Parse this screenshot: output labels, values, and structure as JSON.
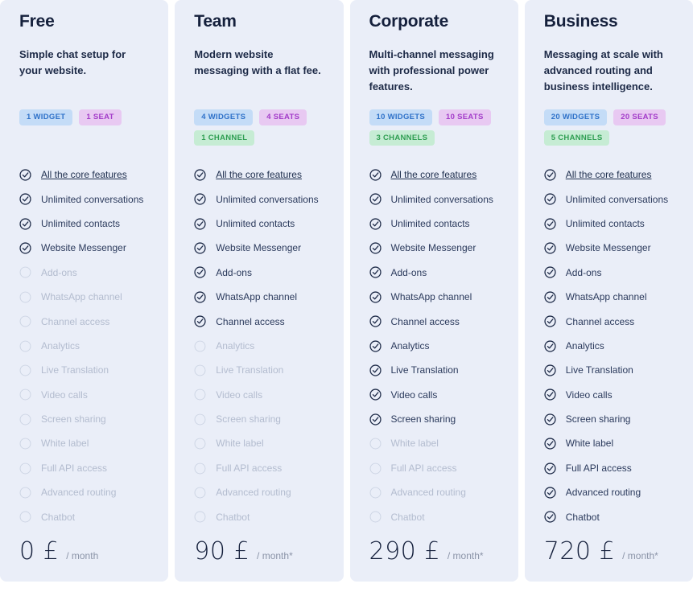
{
  "colors": {
    "page_background": "#ffffff",
    "card_background": "#eaeef8",
    "heading": "#15203c",
    "feature_on": "#2b3a5c",
    "feature_off": "#b3bccf",
    "badge_widgets_bg": "#c4dcf7",
    "badge_widgets_text": "#2f72c9",
    "badge_seats_bg": "#e8c9f2",
    "badge_seats_text": "#a33cc9",
    "badge_channels_bg": "#c6ecd4",
    "badge_channels_text": "#2f9e52"
  },
  "plans": [
    {
      "name": "Free",
      "description": "Simple chat setup for your website.",
      "badges": [
        {
          "label": "1 WIDGET",
          "type": "widgets"
        },
        {
          "label": "1 SEAT",
          "type": "seats"
        }
      ],
      "features": [
        {
          "label": "All the core features",
          "enabled": true,
          "link": true
        },
        {
          "label": "Unlimited conversations",
          "enabled": true,
          "link": false
        },
        {
          "label": "Unlimited contacts",
          "enabled": true,
          "link": false
        },
        {
          "label": "Website Messenger",
          "enabled": true,
          "link": false
        },
        {
          "label": "Add-ons",
          "enabled": false,
          "link": false
        },
        {
          "label": "WhatsApp channel",
          "enabled": false,
          "link": false
        },
        {
          "label": "Channel access",
          "enabled": false,
          "link": false
        },
        {
          "label": "Analytics",
          "enabled": false,
          "link": false
        },
        {
          "label": "Live Translation",
          "enabled": false,
          "link": false
        },
        {
          "label": "Video calls",
          "enabled": false,
          "link": false
        },
        {
          "label": "Screen sharing",
          "enabled": false,
          "link": false
        },
        {
          "label": "White label",
          "enabled": false,
          "link": false
        },
        {
          "label": "Full API access",
          "enabled": false,
          "link": false
        },
        {
          "label": "Advanced routing",
          "enabled": false,
          "link": false
        },
        {
          "label": "Chatbot",
          "enabled": false,
          "link": false
        }
      ],
      "price_amount": "0 £",
      "price_period": "/ month"
    },
    {
      "name": "Team",
      "description": "Modern website messaging with a flat fee.",
      "badges": [
        {
          "label": "4 WIDGETS",
          "type": "widgets"
        },
        {
          "label": "4 SEATS",
          "type": "seats"
        },
        {
          "label": "1 CHANNEL",
          "type": "channels"
        }
      ],
      "features": [
        {
          "label": "All the core features",
          "enabled": true,
          "link": true
        },
        {
          "label": "Unlimited conversations",
          "enabled": true,
          "link": false
        },
        {
          "label": "Unlimited contacts",
          "enabled": true,
          "link": false
        },
        {
          "label": "Website Messenger",
          "enabled": true,
          "link": false
        },
        {
          "label": "Add-ons",
          "enabled": true,
          "link": false
        },
        {
          "label": "WhatsApp channel",
          "enabled": true,
          "link": false
        },
        {
          "label": "Channel access",
          "enabled": true,
          "link": false
        },
        {
          "label": "Analytics",
          "enabled": false,
          "link": false
        },
        {
          "label": "Live Translation",
          "enabled": false,
          "link": false
        },
        {
          "label": "Video calls",
          "enabled": false,
          "link": false
        },
        {
          "label": "Screen sharing",
          "enabled": false,
          "link": false
        },
        {
          "label": "White label",
          "enabled": false,
          "link": false
        },
        {
          "label": "Full API access",
          "enabled": false,
          "link": false
        },
        {
          "label": "Advanced routing",
          "enabled": false,
          "link": false
        },
        {
          "label": "Chatbot",
          "enabled": false,
          "link": false
        }
      ],
      "price_amount": "90 £",
      "price_period": "/ month*"
    },
    {
      "name": "Corporate",
      "description": "Multi-channel messaging with professional power features.",
      "badges": [
        {
          "label": "10 WIDGETS",
          "type": "widgets"
        },
        {
          "label": "10 SEATS",
          "type": "seats"
        },
        {
          "label": "3 CHANNELS",
          "type": "channels"
        }
      ],
      "features": [
        {
          "label": "All the core features",
          "enabled": true,
          "link": true
        },
        {
          "label": "Unlimited conversations",
          "enabled": true,
          "link": false
        },
        {
          "label": "Unlimited contacts",
          "enabled": true,
          "link": false
        },
        {
          "label": "Website Messenger",
          "enabled": true,
          "link": false
        },
        {
          "label": "Add-ons",
          "enabled": true,
          "link": false
        },
        {
          "label": "WhatsApp channel",
          "enabled": true,
          "link": false
        },
        {
          "label": "Channel access",
          "enabled": true,
          "link": false
        },
        {
          "label": "Analytics",
          "enabled": true,
          "link": false
        },
        {
          "label": "Live Translation",
          "enabled": true,
          "link": false
        },
        {
          "label": "Video calls",
          "enabled": true,
          "link": false
        },
        {
          "label": "Screen sharing",
          "enabled": true,
          "link": false
        },
        {
          "label": "White label",
          "enabled": false,
          "link": false
        },
        {
          "label": "Full API access",
          "enabled": false,
          "link": false
        },
        {
          "label": "Advanced routing",
          "enabled": false,
          "link": false
        },
        {
          "label": "Chatbot",
          "enabled": false,
          "link": false
        }
      ],
      "price_amount": "290 £",
      "price_period": "/ month*"
    },
    {
      "name": "Business",
      "description": "Messaging at scale with advanced routing and business intelligence.",
      "badges": [
        {
          "label": "20 WIDGETS",
          "type": "widgets"
        },
        {
          "label": "20 SEATS",
          "type": "seats"
        },
        {
          "label": "5 CHANNELS",
          "type": "channels"
        }
      ],
      "features": [
        {
          "label": "All the core features",
          "enabled": true,
          "link": true
        },
        {
          "label": "Unlimited conversations",
          "enabled": true,
          "link": false
        },
        {
          "label": "Unlimited contacts",
          "enabled": true,
          "link": false
        },
        {
          "label": "Website Messenger",
          "enabled": true,
          "link": false
        },
        {
          "label": "Add-ons",
          "enabled": true,
          "link": false
        },
        {
          "label": "WhatsApp channel",
          "enabled": true,
          "link": false
        },
        {
          "label": "Channel access",
          "enabled": true,
          "link": false
        },
        {
          "label": "Analytics",
          "enabled": true,
          "link": false
        },
        {
          "label": "Live Translation",
          "enabled": true,
          "link": false
        },
        {
          "label": "Video calls",
          "enabled": true,
          "link": false
        },
        {
          "label": "Screen sharing",
          "enabled": true,
          "link": false
        },
        {
          "label": "White label",
          "enabled": true,
          "link": false
        },
        {
          "label": "Full API access",
          "enabled": true,
          "link": false
        },
        {
          "label": "Advanced routing",
          "enabled": true,
          "link": false
        },
        {
          "label": "Chatbot",
          "enabled": true,
          "link": false
        }
      ],
      "price_amount": "720 £",
      "price_period": "/ month*"
    }
  ]
}
